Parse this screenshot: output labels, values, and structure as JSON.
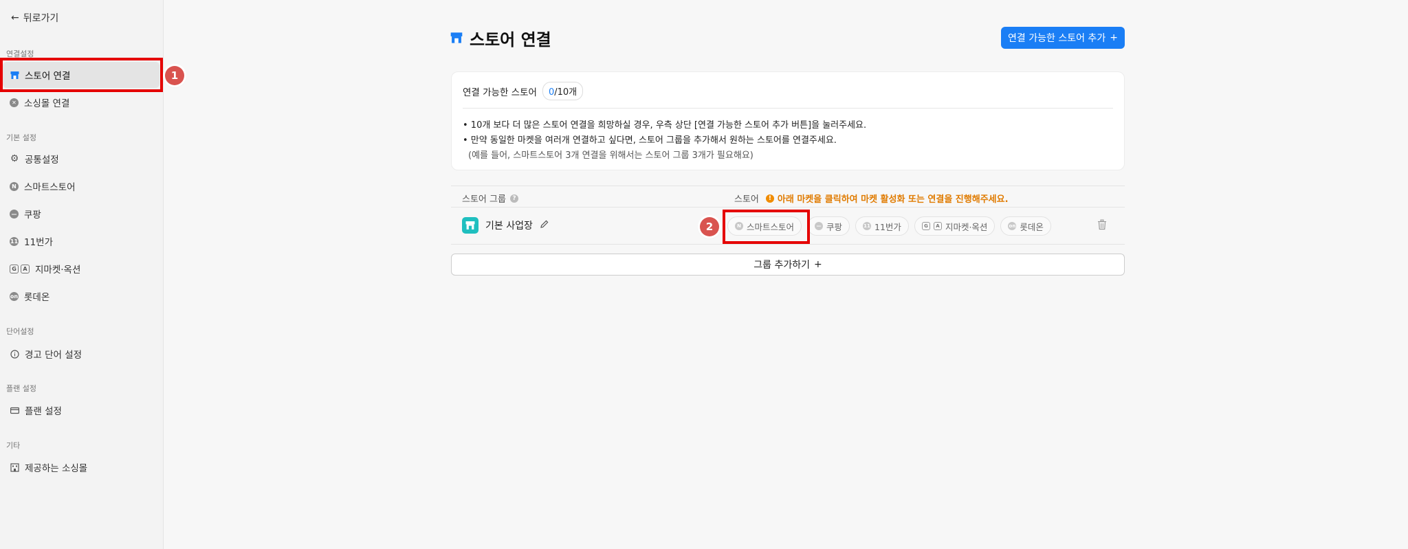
{
  "sidebar": {
    "back_label": "뒤로가기",
    "sections": {
      "connect": "연결설정",
      "basic": "기본 설정",
      "words": "단어설정",
      "plan": "플랜 설정",
      "etc": "기타"
    },
    "items": {
      "store_connect": "스토어 연결",
      "social_connect": "소싱몰 연결",
      "common": "공통설정",
      "smartstore": "스마트스토어",
      "coupang": "쿠팡",
      "st11": "11번가",
      "gmarket": "지마켓·옥션",
      "lotteon": "롯데온",
      "warn_words": "경고 단어 설정",
      "plan": "플랜 설정",
      "provided": "제공하는 소싱몰"
    }
  },
  "annotations": {
    "step1": "1",
    "step2": "2"
  },
  "main": {
    "title": "스토어 연결",
    "add_store_button": "연결 가능한 스토어 추가",
    "add_plus": "+",
    "info": {
      "label": "연결 가능한 스토어",
      "count_current": "0",
      "count_rest": "/10개",
      "bullet1": "• 10개 보다 더 많은 스토어 연결을 희망하실 경우, 우측 상단 [연결 가능한 스토어 추가 버튼]을 눌러주세요.",
      "bullet2": "• 만약 동일한 마켓을 여러개 연결하고 싶다면, 스토어 그룹을 추가해서 원하는 스토어를 연결주세요.",
      "note": "(예를 들어, 스마트스토어 3개 연결을 위해서는 스토어 그룹 3개가 필요해요)"
    },
    "table": {
      "col_group": "스토어 그룹",
      "col_store": "스토어",
      "warning": "아래 마켓을 클릭하여 마켓 활성화 또는 연결을 진행해주세요.",
      "row": {
        "group_name": "기본 사업장",
        "chips": [
          "스마트스토어",
          "쿠팡",
          "11번가",
          "지마켓·옥션",
          "롯데온"
        ]
      }
    },
    "add_group_button": "그룹 추가하기"
  },
  "colors": {
    "accent": "#1a7ef5",
    "highlight": "#e50000",
    "warning": "#e07b00",
    "badge": "#d9534f"
  }
}
